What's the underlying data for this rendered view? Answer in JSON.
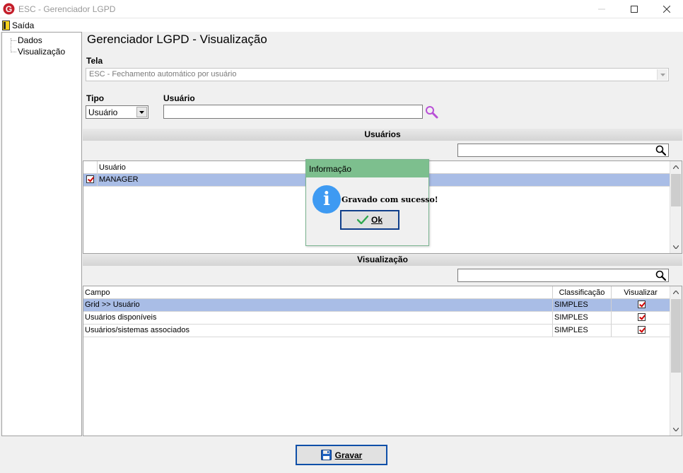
{
  "window": {
    "title": "ESC - Gerenciador LGPD"
  },
  "menu": {
    "exit_label": "Saída"
  },
  "tree": {
    "items": [
      "Dados",
      "Visualização"
    ]
  },
  "page": {
    "title": "Gerenciador LGPD - Visualização",
    "tela_label": "Tela",
    "tela_value": "ESC - Fechamento automático por usuário",
    "tipo_label": "Tipo",
    "tipo_value": "Usuário",
    "usuario_label": "Usuário",
    "usuario_value": ""
  },
  "usuarios_section": {
    "title": "Usuários",
    "filter_value": "",
    "columns": [
      "Usuário"
    ],
    "rows": [
      {
        "checked": true,
        "name": "MANAGER",
        "selected": true
      }
    ]
  },
  "visualizacao_section": {
    "title": "Visualização",
    "filter_value": "",
    "columns": [
      "Campo",
      "Classificação",
      "Visualizar"
    ],
    "rows": [
      {
        "campo": "Grid >> Usuário",
        "classificacao": "SIMPLES",
        "visualizar": true,
        "selected": true
      },
      {
        "campo": "Usuários disponíveis",
        "classificacao": "SIMPLES",
        "visualizar": true,
        "selected": false
      },
      {
        "campo": "Usuários/sistemas associados",
        "classificacao": "SIMPLES",
        "visualizar": true,
        "selected": false
      }
    ]
  },
  "footer": {
    "save_label": "Gravar"
  },
  "dialog": {
    "title": "Informação",
    "message": "Gravado com sucesso!",
    "ok_label": "Ok",
    "icon": "info-icon"
  },
  "colors": {
    "selection": "#a9bde6",
    "dialog_title": "#7dbf8e",
    "info_icon": "#3e9af2",
    "button_border": "#0f4fa8",
    "check": "#d00000"
  }
}
